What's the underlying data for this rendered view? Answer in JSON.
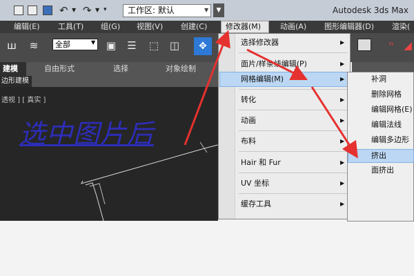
{
  "title_bar": {
    "workspace_label": "工作区: 默认",
    "app_title": "Autodesk 3ds Max"
  },
  "menu_bar": {
    "items": [
      "编辑(E)",
      "工具(T)",
      "组(G)",
      "视图(V)",
      "创建(C)",
      "修改器(M)",
      "动画(A)",
      "图形编辑器(D)",
      "渲染("
    ],
    "active": "修改器(M)"
  },
  "toolbar": {
    "selection_filter": "全部"
  },
  "ribbon": {
    "tabs": [
      "建模",
      "自由形式",
      "选择",
      "对象绘制"
    ],
    "sub_tab": "边形建模"
  },
  "viewport": {
    "label": "透视 ] [ 真实 ]",
    "overlay_text": "选中图片后"
  },
  "dropdown": {
    "items": [
      {
        "label": "选择修改器",
        "has_submenu": true
      },
      {
        "label": "面片/样条线编辑(P)",
        "has_submenu": true
      },
      {
        "label": "网格编辑(M)",
        "has_submenu": true,
        "highlighted": true
      },
      {
        "label": "转化",
        "has_submenu": true
      },
      {
        "label": "动画",
        "has_submenu": true
      },
      {
        "label": "布料",
        "has_submenu": true
      },
      {
        "label": "Hair 和 Fur",
        "has_submenu": true
      },
      {
        "label": "UV 坐标",
        "has_submenu": true
      },
      {
        "label": "缓存工具",
        "has_submenu": true
      }
    ]
  },
  "submenu": {
    "items": [
      {
        "label": "补洞"
      },
      {
        "label": "删除网格"
      },
      {
        "label": "编辑网格(E)"
      },
      {
        "label": "编辑法线"
      },
      {
        "label": "编辑多边形"
      },
      {
        "label": "挤出",
        "highlighted": true
      },
      {
        "label": "面挤出"
      }
    ]
  },
  "annotation": {
    "arrow_color": "#e5312f"
  }
}
